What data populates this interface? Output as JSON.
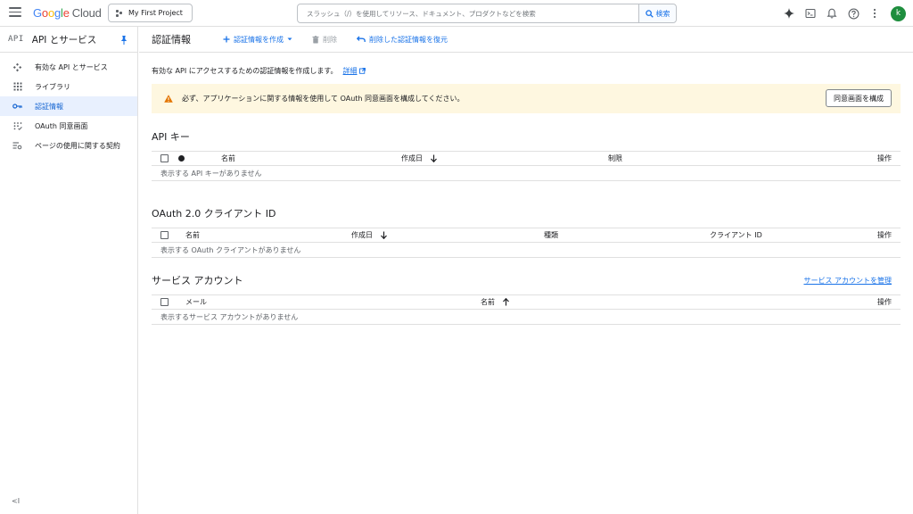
{
  "header": {
    "logo_google": [
      "G",
      "o",
      "o",
      "g",
      "l",
      "e"
    ],
    "logo_cloud": "Cloud",
    "project": "My First Project",
    "search_placeholder": "スラッシュ（/）を使用してリソース、ドキュメント、プロダクトなどを検索",
    "search_button": "検索",
    "avatar_letter": "k"
  },
  "sidebar": {
    "api_label": "API",
    "title": "API とサービス",
    "items": [
      {
        "label": "有効な API とサービス",
        "icon": "api-diamond-icon"
      },
      {
        "label": "ライブラリ",
        "icon": "library-grid-icon"
      },
      {
        "label": "認証情報",
        "icon": "key-icon",
        "active": true
      },
      {
        "label": "OAuth 同意画面",
        "icon": "oauth-consent-icon"
      },
      {
        "label": "ページの使用に関する契約",
        "icon": "settings-list-icon"
      }
    ],
    "collapse": "<I"
  },
  "toolbar": {
    "title": "認証情報",
    "create": "認証情報を作成",
    "delete": "削除",
    "restore": "削除した認証情報を復元"
  },
  "intro": {
    "text": "有効な API にアクセスするための認証情報を作成します。",
    "link": "詳細"
  },
  "banner": {
    "text": "必ず、アプリケーションに関する情報を使用して OAuth 同意画面を構成してください。",
    "button": "同意画面を構成"
  },
  "api_keys": {
    "title": "API キー",
    "col_name": "名前",
    "col_created": "作成日",
    "col_restrictions": "制限",
    "col_actions": "操作",
    "empty": "表示する API キーがありません"
  },
  "oauth": {
    "title": "OAuth 2.0 クライアント ID",
    "col_name": "名前",
    "col_created": "作成日",
    "col_type": "種類",
    "col_client_id": "クライアント ID",
    "col_actions": "操作",
    "empty": "表示する OAuth クライアントがありません"
  },
  "service_accounts": {
    "title": "サービス アカウント",
    "manage_link": "サービス アカウントを管理",
    "col_email": "メール",
    "col_name": "名前",
    "col_actions": "操作",
    "empty": "表示するサービス アカウントがありません"
  }
}
